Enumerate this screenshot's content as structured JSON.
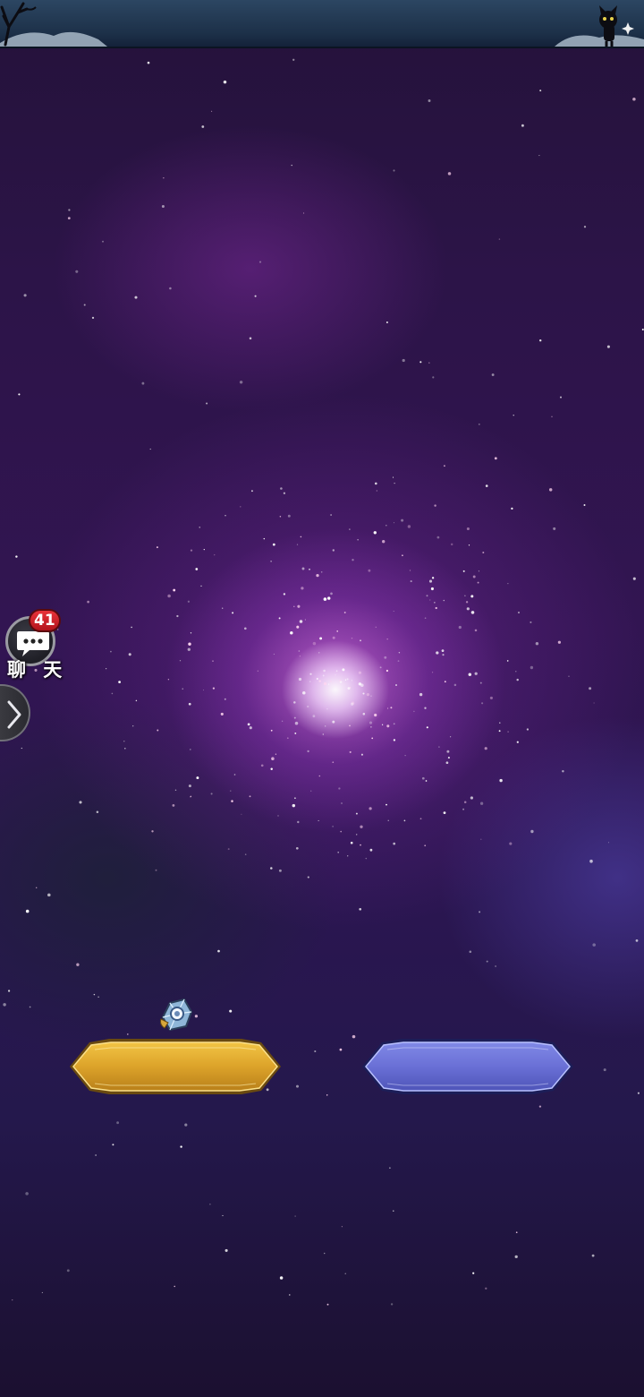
{
  "chat": {
    "unread_count": "41",
    "label": "聊 天",
    "icon": "chat-bubble-icon"
  },
  "expand_tab": {
    "icon": "chevron-right-icon"
  },
  "buttons": {
    "gold": {
      "label": "",
      "color": "#e0a82a"
    },
    "blue": {
      "label": "",
      "color": "#6a72d8"
    }
  },
  "currency_icon": "crystal-gem-icon",
  "colors": {
    "top_bar": "#1d3149",
    "background": "#2c1448",
    "galaxy_core": "#ffffff",
    "badge": "#d0232b"
  }
}
